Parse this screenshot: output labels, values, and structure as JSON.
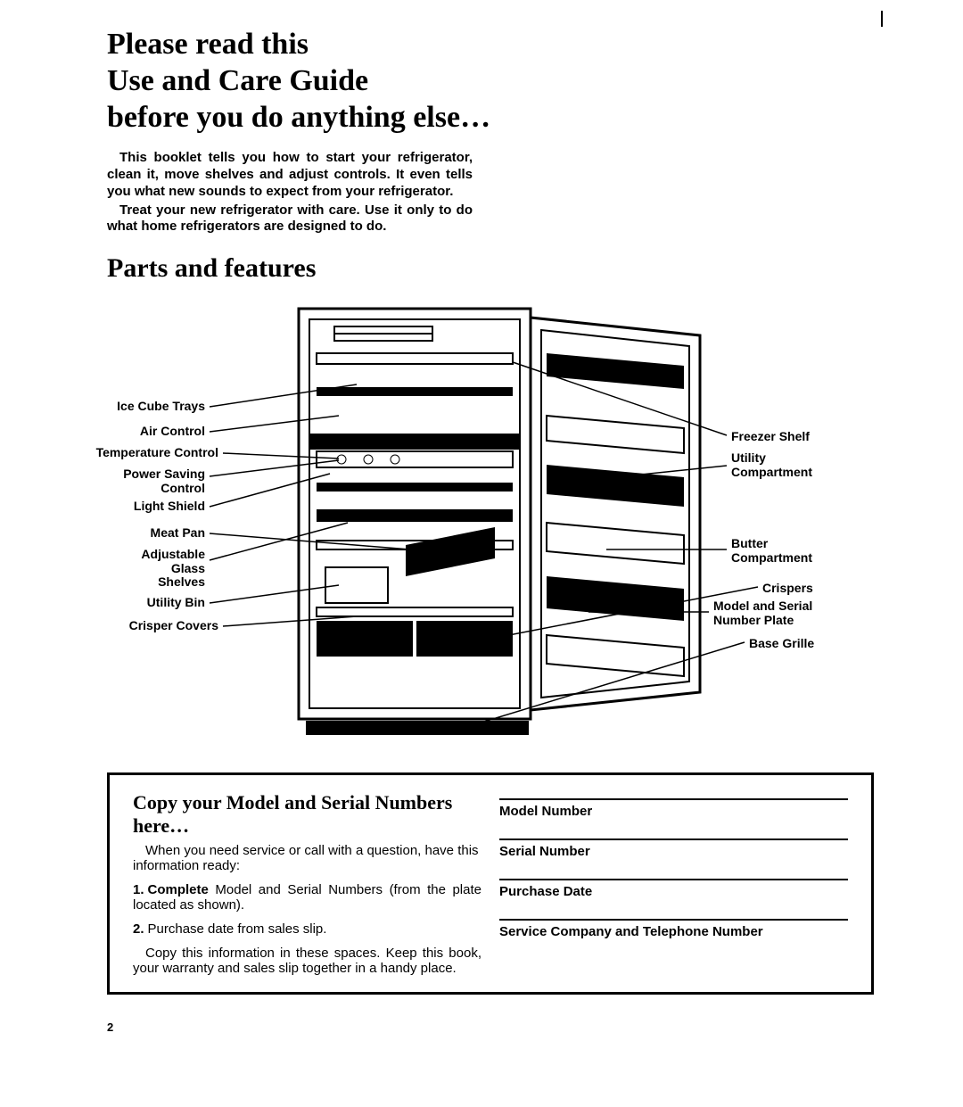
{
  "title": "Please read this\nUse and Care Guide\nbefore you do anything else…",
  "intro": {
    "p1": "This booklet tells you how to start your refrigerator, clean it, move shelves and adjust controls. It even tells you what new sounds to expect from your refrigerator.",
    "p2": "Treat your new refrigerator with care. Use it only to do what home refrigerators are designed to do."
  },
  "parts_heading": "Parts and features",
  "labels": {
    "left": [
      "Ice Cube Trays",
      "Air Control",
      "Temperature Control",
      "Power Saving\nControl",
      "Light Shield",
      "Meat Pan",
      "Adjustable\nGlass\nShelves",
      "Utility Bin",
      "Crisper Covers"
    ],
    "right": [
      "Freezer Shelf",
      "Utility\nCompartment",
      "Butter\nCompartment",
      "Crispers",
      "Model and Serial\nNumber Plate",
      "Base Grille"
    ]
  },
  "record": {
    "heading": "Copy your Model and Serial Numbers here…",
    "lead": "When you need service or call with a question, have this information ready:",
    "items": [
      {
        "num": "1.",
        "bold": "Complete",
        "rest": " Model and Serial Numbers (from the plate located as shown)."
      },
      {
        "num": "2.",
        "bold": "",
        "rest": "Purchase date from sales slip."
      }
    ],
    "tail": "Copy this information in these spaces. Keep this book, your warranty and sales slip together in a handy place.",
    "fields": [
      "Model Number",
      "Serial Number",
      "Purchase Date",
      "Service Company and Telephone Number"
    ]
  },
  "page_number": "2"
}
